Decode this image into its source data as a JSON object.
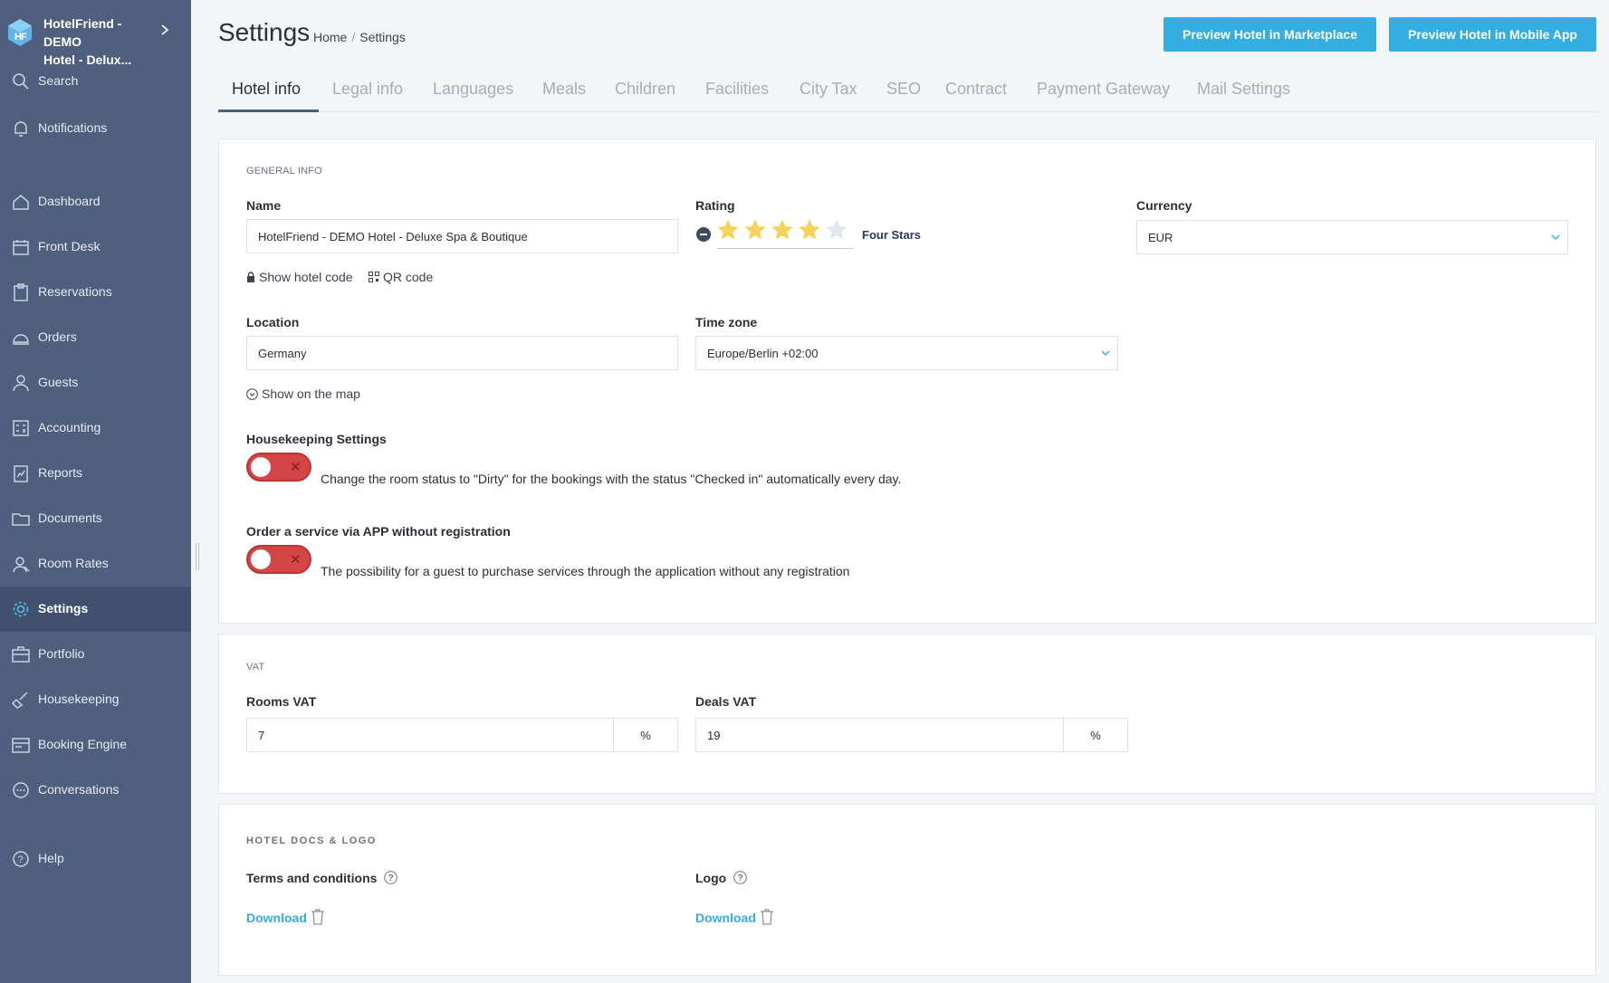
{
  "brand": {
    "name_line1": "HotelFriend - DEMO",
    "name_line2": "Hotel - Delux..."
  },
  "sidebar": {
    "items": [
      {
        "label": "Search",
        "icon": "search-icon"
      },
      {
        "label": "Notifications",
        "icon": "bell-icon"
      },
      {
        "label": "Dashboard",
        "icon": "home-icon"
      },
      {
        "label": "Front Desk",
        "icon": "calendar-icon"
      },
      {
        "label": "Reservations",
        "icon": "clipboard-icon"
      },
      {
        "label": "Orders",
        "icon": "cloche-icon"
      },
      {
        "label": "Guests",
        "icon": "user-icon"
      },
      {
        "label": "Accounting",
        "icon": "calculator-icon"
      },
      {
        "label": "Reports",
        "icon": "report-icon"
      },
      {
        "label": "Documents",
        "icon": "folder-icon"
      },
      {
        "label": "Room Rates",
        "icon": "rates-icon"
      },
      {
        "label": "Settings",
        "icon": "gear-icon",
        "active": true
      },
      {
        "label": "Portfolio",
        "icon": "portfolio-icon"
      },
      {
        "label": "Housekeeping",
        "icon": "broom-icon"
      },
      {
        "label": "Booking Engine",
        "icon": "booking-icon"
      },
      {
        "label": "Conversations",
        "icon": "chat-icon"
      },
      {
        "label": "Help",
        "icon": "help-icon"
      }
    ]
  },
  "header": {
    "title": "Settings",
    "breadcrumb": [
      "Home",
      "Settings"
    ],
    "buttons": {
      "marketplace": "Preview Hotel in Marketplace",
      "mobile_app": "Preview Hotel in Mobile App"
    }
  },
  "tabs": [
    "Hotel info",
    "Legal info",
    "Languages",
    "Meals",
    "Children",
    "Facilities",
    "City Tax",
    "SEO",
    "Contract",
    "Payment Gateway",
    "Mail Settings"
  ],
  "general": {
    "section_title": "GENERAL INFO",
    "name_label": "Name",
    "name_value": "HotelFriend - DEMO Hotel - Deluxe Spa & Boutique",
    "rating_label": "Rating",
    "rating_value": 4,
    "rating_max": 5,
    "rating_text": "Four Stars",
    "currency_label": "Currency",
    "currency_value": "EUR",
    "show_hotel_code": "Show hotel code",
    "qr_code": "QR code",
    "location_label": "Location",
    "location_value": "Germany",
    "timezone_label": "Time zone",
    "timezone_value": "Europe/Berlin +02:00",
    "show_on_map": "Show on the map",
    "housekeeping_label": "Housekeeping Settings",
    "housekeeping_desc": "Change the room status to \"Dirty\" for the bookings with the status \"Checked in\" automatically every day.",
    "housekeeping_enabled": false,
    "order_label": "Order a service via APP without registration",
    "order_desc": "The possibility for a guest to purchase services through the application without any registration",
    "order_enabled": false
  },
  "vat": {
    "section_title": "VAT",
    "rooms_label": "Rooms VAT",
    "rooms_value": "7",
    "deals_label": "Deals VAT",
    "deals_value": "19",
    "unit": "%"
  },
  "docs": {
    "section_title": "HOTEL DOCS & LOGO",
    "terms_label": "Terms and conditions",
    "logo_label": "Logo",
    "download": "Download"
  },
  "colors": {
    "sidebar_bg": "#4f5f7e",
    "accent": "#34aee0",
    "toggle_off": "#d64545",
    "star": "#f5d35b"
  }
}
